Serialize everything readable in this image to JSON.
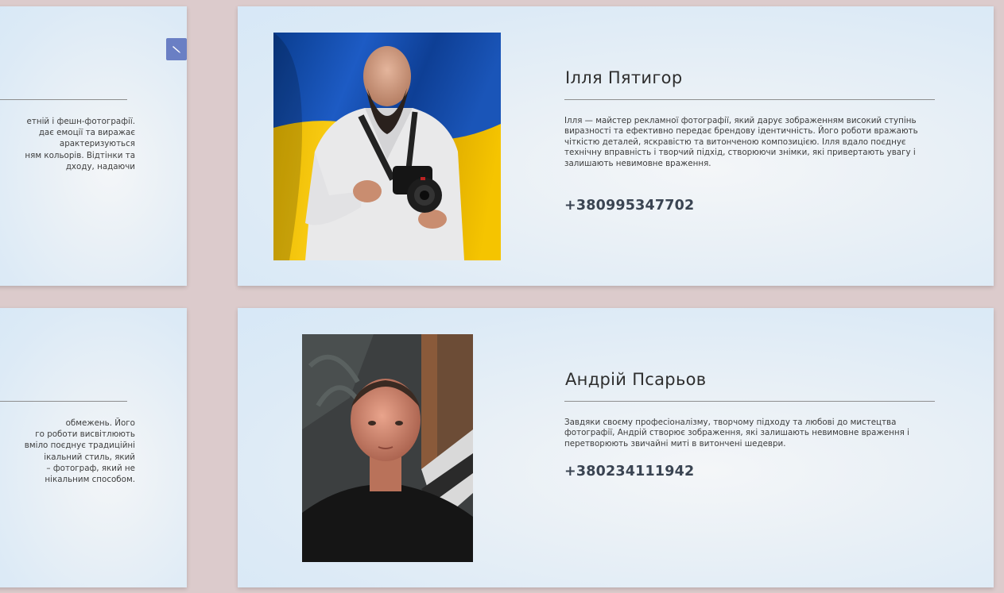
{
  "cards": [
    {
      "name": "Ілля Пятигор",
      "bio": "Ілля — майстер рекламної фотографії, який дарує зображенням високий ступінь виразності та ефективно передає брендову ідентичність. Його роботи вражають чіткістю деталей, яскравістю та витонченою композицією. Ілля вдало поєднує технічну вправність і творчий підхід, створюючи знімки, які привертають увагу і залишають невимовне враження.",
      "phone": "+380995347702"
    },
    {
      "name": "Андрій Псарьов",
      "bio": "Завдяки своєму професіоналізму, творчому підходу та любові до мистецтва фотографії, Андрій створює зображення, які залишають невимовне враження і перетворюють звичайні миті в витончені шедеври.",
      "phone": "+380234111942"
    }
  ],
  "left_cards": [
    {
      "lines": [
        "етній і фешн-фотографії.",
        "дає емоції та виражає",
        "арактеризуються",
        "ням кольорів. Відтінки та",
        "дходу, надаючи"
      ]
    },
    {
      "lines": [
        " обмежень. Його",
        "го роботи висвітлюють",
        "вміло поєднує традиційні",
        "ікальний стиль, який",
        "– фотограф, який не",
        "нікальним способом."
      ]
    }
  ],
  "icons": {
    "edit": "pencil-icon"
  },
  "colors": {
    "page_background": "#dccbcc",
    "edit_button": "#6a7fc4",
    "phone_text": "#3a4452"
  }
}
